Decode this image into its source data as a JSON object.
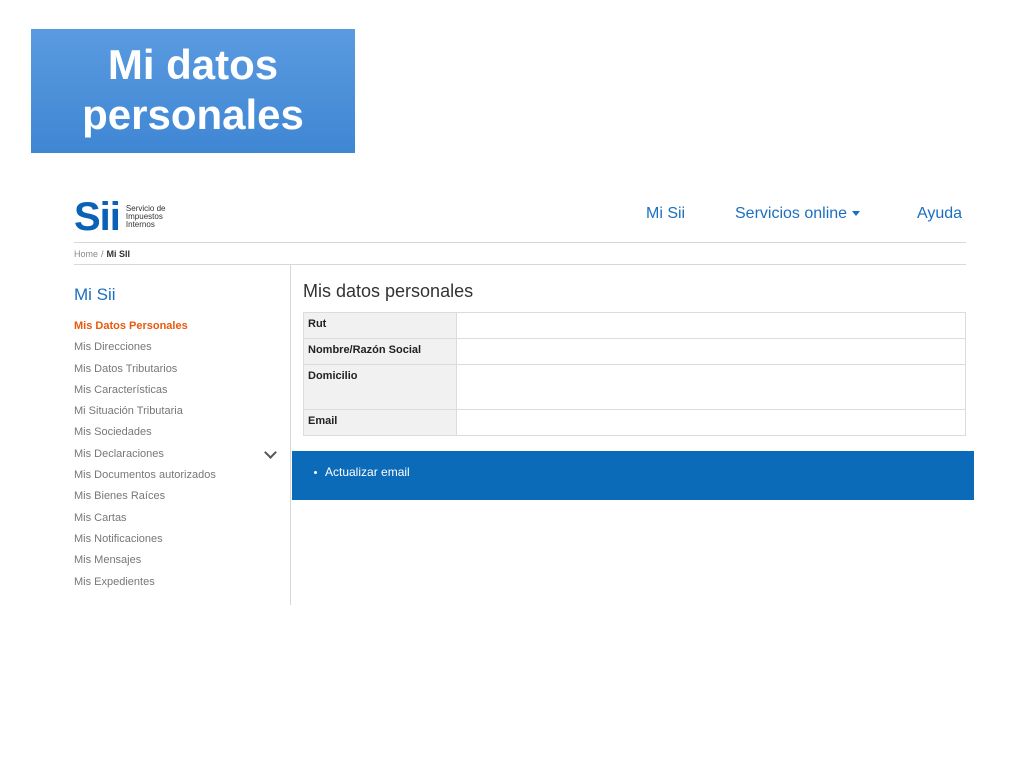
{
  "slide": {
    "title_line1": "Mi datos",
    "title_line2": "personales"
  },
  "header": {
    "logo_mark": "Sii",
    "logo_text": [
      "Servicio de",
      "Impuestos",
      "Internos"
    ],
    "nav": {
      "mi_sii": "Mi Sii",
      "servicios_online": "Servicios online",
      "ayuda": "Ayuda"
    }
  },
  "breadcrumb": {
    "home": "Home",
    "separator": "/",
    "current": "Mi SII"
  },
  "sidebar": {
    "title": "Mi Sii",
    "items": [
      {
        "label": "Mis Datos Personales",
        "active": true
      },
      {
        "label": "Mis Direcciones"
      },
      {
        "label": "Mis Datos Tributarios"
      },
      {
        "label": "Mis Características"
      },
      {
        "label": "Mi Situación Tributaria"
      },
      {
        "label": "Mis Sociedades"
      },
      {
        "label": "Mis Declaraciones"
      },
      {
        "label": "Mis Documentos autorizados"
      },
      {
        "label": "Mis Bienes Raíces"
      },
      {
        "label": "Mis Cartas"
      },
      {
        "label": "Mis Notificaciones"
      },
      {
        "label": "Mis Mensajes"
      },
      {
        "label": "Mis Expedientes"
      }
    ]
  },
  "main": {
    "title": "Mis datos personales",
    "table": {
      "rows": [
        {
          "label": "Rut",
          "value": ""
        },
        {
          "label": "Nombre/Razón Social",
          "value": ""
        },
        {
          "label": "Domicilio",
          "value": ""
        },
        {
          "label": "Email",
          "value": ""
        }
      ]
    },
    "action": {
      "label": "Actualizar email"
    }
  },
  "colors": {
    "brand_blue": "#0b6bb8",
    "link_blue": "#1c6fbf",
    "active_orange": "#e8590c",
    "title_box": "#4a90d9"
  },
  "icons": {
    "dropdown": "caret-down-icon",
    "expand": "chevron-down-icon",
    "action_bullet": "bullet-icon"
  }
}
